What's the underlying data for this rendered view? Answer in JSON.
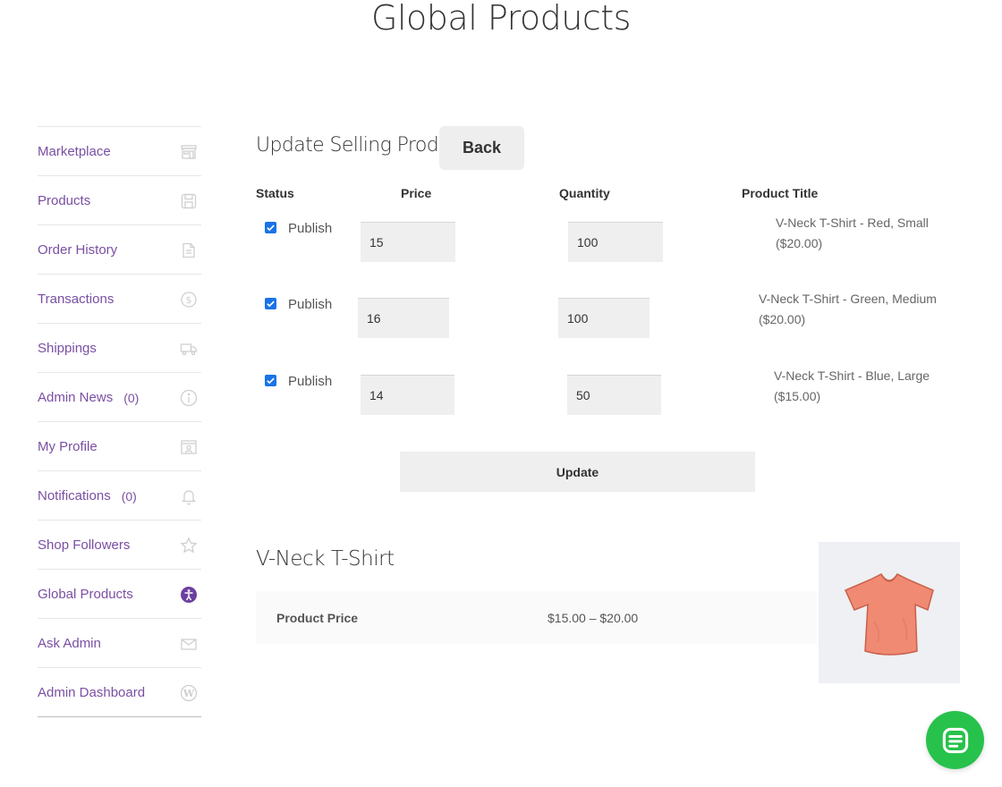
{
  "page": {
    "title": "Global Products"
  },
  "sidebar": {
    "items": [
      {
        "label": "Marketplace",
        "icon": "storefront-icon"
      },
      {
        "label": "Products",
        "icon": "floppy-icon"
      },
      {
        "label": "Order History",
        "icon": "document-icon"
      },
      {
        "label": "Transactions",
        "icon": "dollar-icon"
      },
      {
        "label": "Shippings",
        "icon": "truck-icon"
      },
      {
        "label": "Admin News",
        "count": "(0)",
        "icon": "info-icon"
      },
      {
        "label": "My Profile",
        "icon": "profile-card-icon"
      },
      {
        "label": "Notifications",
        "count": "(0)",
        "icon": "bell-icon"
      },
      {
        "label": "Shop Followers",
        "icon": "star-icon"
      },
      {
        "label": "Global Products",
        "icon": "accessibility-icon",
        "active": true
      },
      {
        "label": "Ask Admin",
        "icon": "envelope-icon"
      },
      {
        "label": "Admin Dashboard",
        "icon": "wordpress-icon"
      }
    ]
  },
  "form": {
    "title": "Update Selling Product",
    "back_label": "Back",
    "columns": {
      "status": "Status",
      "price": "Price",
      "quantity": "Quantity",
      "product_title": "Product Title"
    },
    "rows": [
      {
        "checked": true,
        "status": "Publish",
        "price": "15",
        "quantity": "100",
        "title_line1": "V-Neck T-Shirt - Red, Small",
        "title_line2": "($20.00)"
      },
      {
        "checked": true,
        "status": "Publish",
        "price": "16",
        "quantity": "100",
        "title_line1": "V-Neck T-Shirt - Green, Medium",
        "title_line2": "($20.00)"
      },
      {
        "checked": true,
        "status": "Publish",
        "price": "14",
        "quantity": "50",
        "title_line1": "V-Neck T-Shirt - Blue, Large",
        "title_line2": "($15.00)"
      }
    ],
    "update_label": "Update"
  },
  "product": {
    "name": "V-Neck T-Shirt",
    "price_label": "Product Price",
    "price_value": "$15.00 – $20.00"
  },
  "colors": {
    "nav_link": "#7a4fa3",
    "active_icon": "#6b3fa0",
    "checkbox": "#1a73e8",
    "chat": "#27c24c"
  }
}
